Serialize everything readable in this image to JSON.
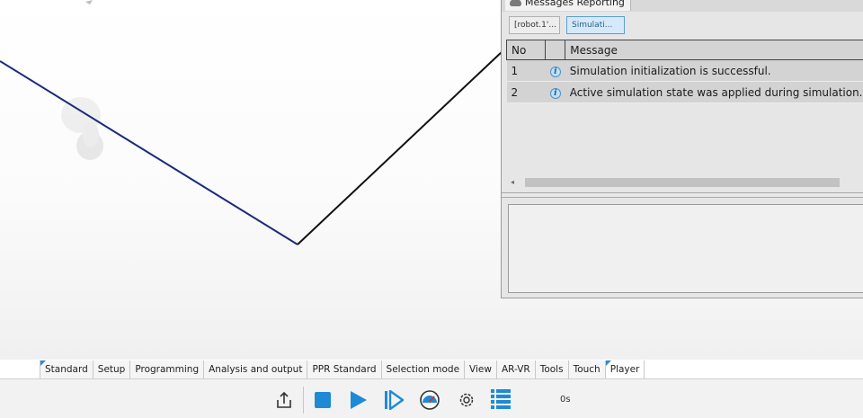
{
  "messages_panel": {
    "title": "Messages Reporting",
    "subtabs": [
      "[robot.1'...",
      "Simulati..."
    ],
    "columns": [
      "No",
      "",
      "Message"
    ],
    "rows": [
      {
        "no": "1",
        "icon": "info-icon",
        "message": "Simulation initialization is successful."
      },
      {
        "no": "2",
        "icon": "info-icon",
        "message": "Active simulation state was applied during simulation."
      }
    ]
  },
  "ribbon": {
    "tabs": [
      "Standard",
      "Setup",
      "Programming",
      "Analysis and output",
      "PPR Standard",
      "Selection mode",
      "View",
      "AR-VR",
      "Tools",
      "Touch",
      "Player"
    ],
    "active_tab": "Player"
  },
  "player_toolbar": {
    "buttons": [
      "export-icon",
      "stop-icon",
      "play-icon",
      "step-forward-icon",
      "speed-gauge-icon",
      "settings-gear-icon",
      "list-icon"
    ],
    "time": "0s"
  },
  "colors": {
    "accent": "#1e8ad6",
    "path_line": "#1b2a7a"
  }
}
